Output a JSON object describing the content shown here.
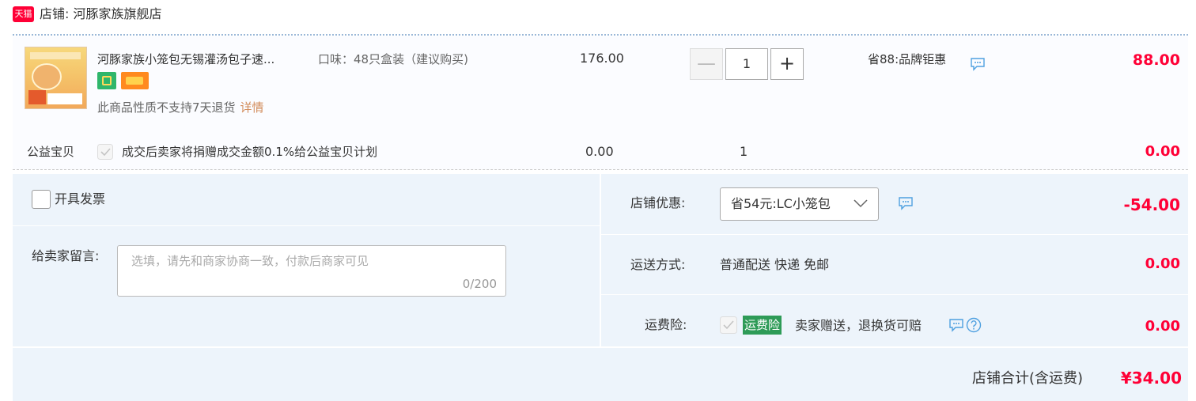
{
  "shop": {
    "logo_text": "天猫",
    "title": "店铺: 河豚家族旗舰店"
  },
  "item": {
    "name": "河豚家族小笼包无锡灌汤包子速...",
    "sku": "口味：48只盒装（建议购买)",
    "no_return_text": "此商品性质不支持7天退货",
    "detail_link": "详情",
    "unit_price": "176.00",
    "quantity": "1",
    "qty_minus": "—",
    "qty_plus": "+",
    "promo": "省88:品牌钜惠",
    "total": "88.00"
  },
  "charity": {
    "label": "公益宝贝",
    "text": "成交后卖家将捐赠成交金额0.1%给公益宝贝计划",
    "price": "0.00",
    "qty": "1",
    "total": "0.00"
  },
  "invoice": {
    "label": "开具发票"
  },
  "message": {
    "label": "给卖家留言:",
    "placeholder": "选填，请先和商家协商一致，付款后商家可见",
    "count": "0/200"
  },
  "coupon": {
    "label": "店铺优惠:",
    "value": "省54元:LC小笼包",
    "amount": "-54.00"
  },
  "shipping": {
    "label": "运送方式:",
    "value": "普通配送 快递 免邮",
    "amount": "0.00"
  },
  "insurance": {
    "label": "运费险:",
    "tag": "运费险",
    "text": "卖家赠送，退换货可赔",
    "amount": "0.00"
  },
  "footer": {
    "label": "店铺合计(含运费)",
    "total": "¥34.00"
  },
  "colors": {
    "accent_red": "#ff0036",
    "tag_green": "#2e9b57",
    "panel_bg": "#edf4fb",
    "icon_blue": "#4fa0e0"
  }
}
